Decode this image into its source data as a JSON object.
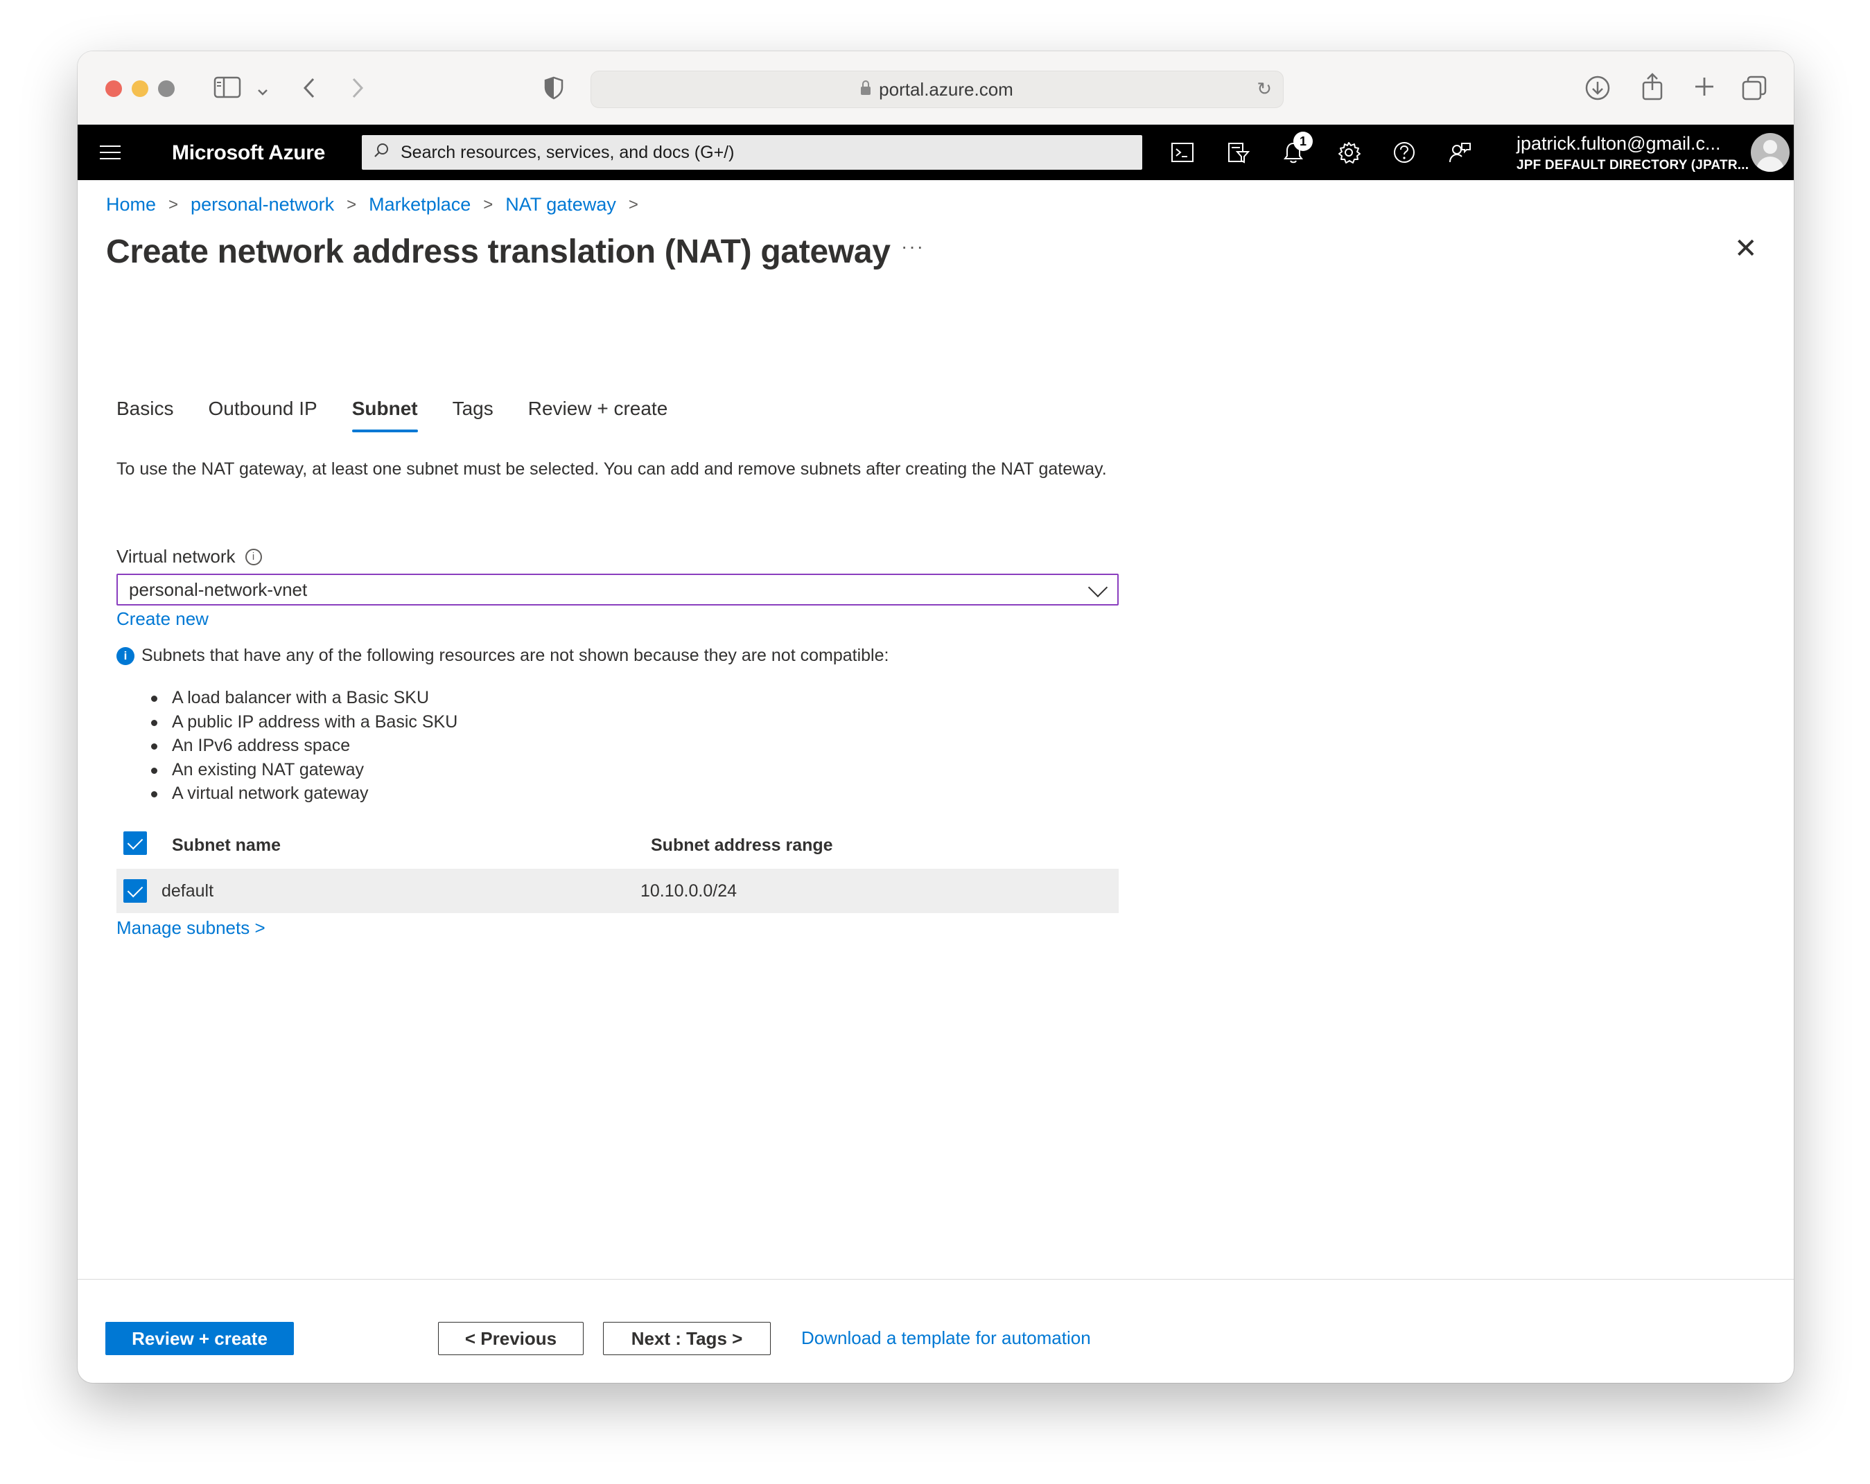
{
  "browser": {
    "url": "portal.azure.com"
  },
  "header": {
    "brand": "Microsoft Azure",
    "search_placeholder": "Search resources, services, and docs (G+/)",
    "notification_count": "1",
    "user_email": "jpatrick.fulton@gmail.c...",
    "user_directory": "JPF DEFAULT DIRECTORY (JPATR..."
  },
  "breadcrumb": [
    "Home",
    "personal-network",
    "Marketplace",
    "NAT gateway"
  ],
  "page": {
    "title": "Create network address translation (NAT) gateway",
    "more": "···",
    "close": "✕"
  },
  "tabs": [
    {
      "label": "Basics",
      "active": false
    },
    {
      "label": "Outbound IP",
      "active": false
    },
    {
      "label": "Subnet",
      "active": true
    },
    {
      "label": "Tags",
      "active": false
    },
    {
      "label": "Review + create",
      "active": false
    }
  ],
  "subnet_tab": {
    "description": "To use the NAT gateway, at least one subnet must be selected. You can add and remove subnets after creating the NAT gateway.",
    "virtual_network_label": "Virtual network",
    "virtual_network_value": "personal-network-vnet",
    "create_new": "Create new",
    "info_note": "Subnets that have any of the following resources are not shown because they are not compatible:",
    "incompatible": [
      "A load balancer with a Basic SKU",
      "A public IP address with a Basic SKU",
      "An IPv6 address space",
      "An existing NAT gateway",
      "A virtual network gateway"
    ],
    "table": {
      "col_name": "Subnet name",
      "col_range": "Subnet address range",
      "rows": [
        {
          "name": "default",
          "range": "10.10.0.0/24",
          "checked": true
        }
      ]
    },
    "manage_subnets": "Manage subnets >"
  },
  "footer": {
    "review_create": "Review + create",
    "previous": "< Previous",
    "next": "Next : Tags >",
    "download": "Download a template for automation"
  },
  "colors": {
    "accent": "#0078d4",
    "header_bg": "#000000",
    "select_border": "#8a3ebf"
  }
}
